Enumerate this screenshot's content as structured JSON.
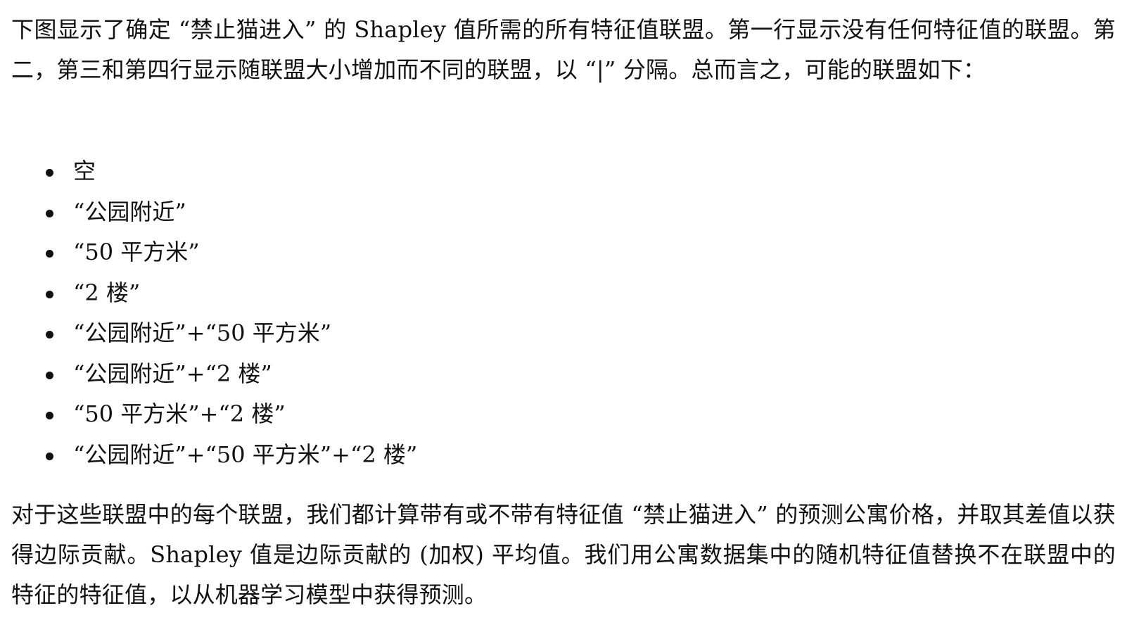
{
  "paragraphs": {
    "intro": "下图显示了确定 “禁止猫进入” 的 Shapley 值所需的所有特征值联盟。第一行显示没有任何特征值的联盟。第二，第三和第四行显示随联盟大小增加而不同的联盟，以 “|” 分隔。总而言之，可能的联盟如下：",
    "outro": "对于这些联盟中的每个联盟，我们都计算带有或不带有特征值 “禁止猫进入” 的预测公寓价格，并取其差值以获得边际贡献。Shapley 值是边际贡献的 (加权) 平均值。我们用公寓数据集中的随机特征值替换不在联盟中的特征的特征值，以从机器学习模型中获得预测。"
  },
  "coalitions": [
    "空",
    "“公园附近”",
    "“50 平方米”",
    "“2 楼”",
    "“公园附近”+“50 平方米”",
    "“公园附近”+“2 楼”",
    "“50 平方米”+“2 楼”",
    "“公园附近”+“50 平方米”+“2 楼”"
  ]
}
